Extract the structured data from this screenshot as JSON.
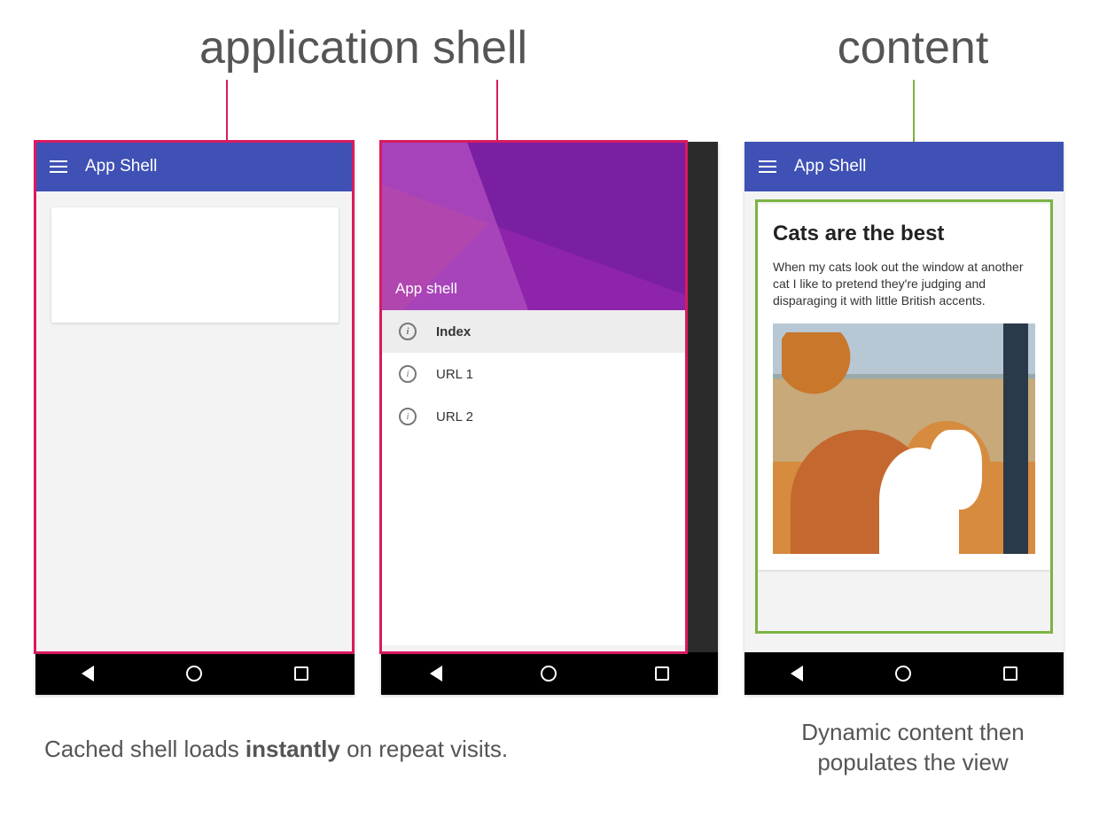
{
  "headings": {
    "shell": "application shell",
    "content": "content"
  },
  "appbar": {
    "title": "App Shell"
  },
  "drawer": {
    "headerLabel": "App shell",
    "items": [
      {
        "label": "Index",
        "active": true
      },
      {
        "label": "URL 1",
        "active": false
      },
      {
        "label": "URL 2",
        "active": false
      }
    ]
  },
  "article": {
    "title": "Cats are the best",
    "body": "When my cats look out the window at another cat I like to pretend they're judging and disparaging it with little British accents."
  },
  "captions": {
    "left_pre": "Cached shell loads ",
    "left_bold": "instantly",
    "left_post": " on repeat visits.",
    "right": "Dynamic content then populates the view"
  },
  "colors": {
    "pink": "#d81b60",
    "green": "#7cb342",
    "appbar": "#3f51b5"
  }
}
